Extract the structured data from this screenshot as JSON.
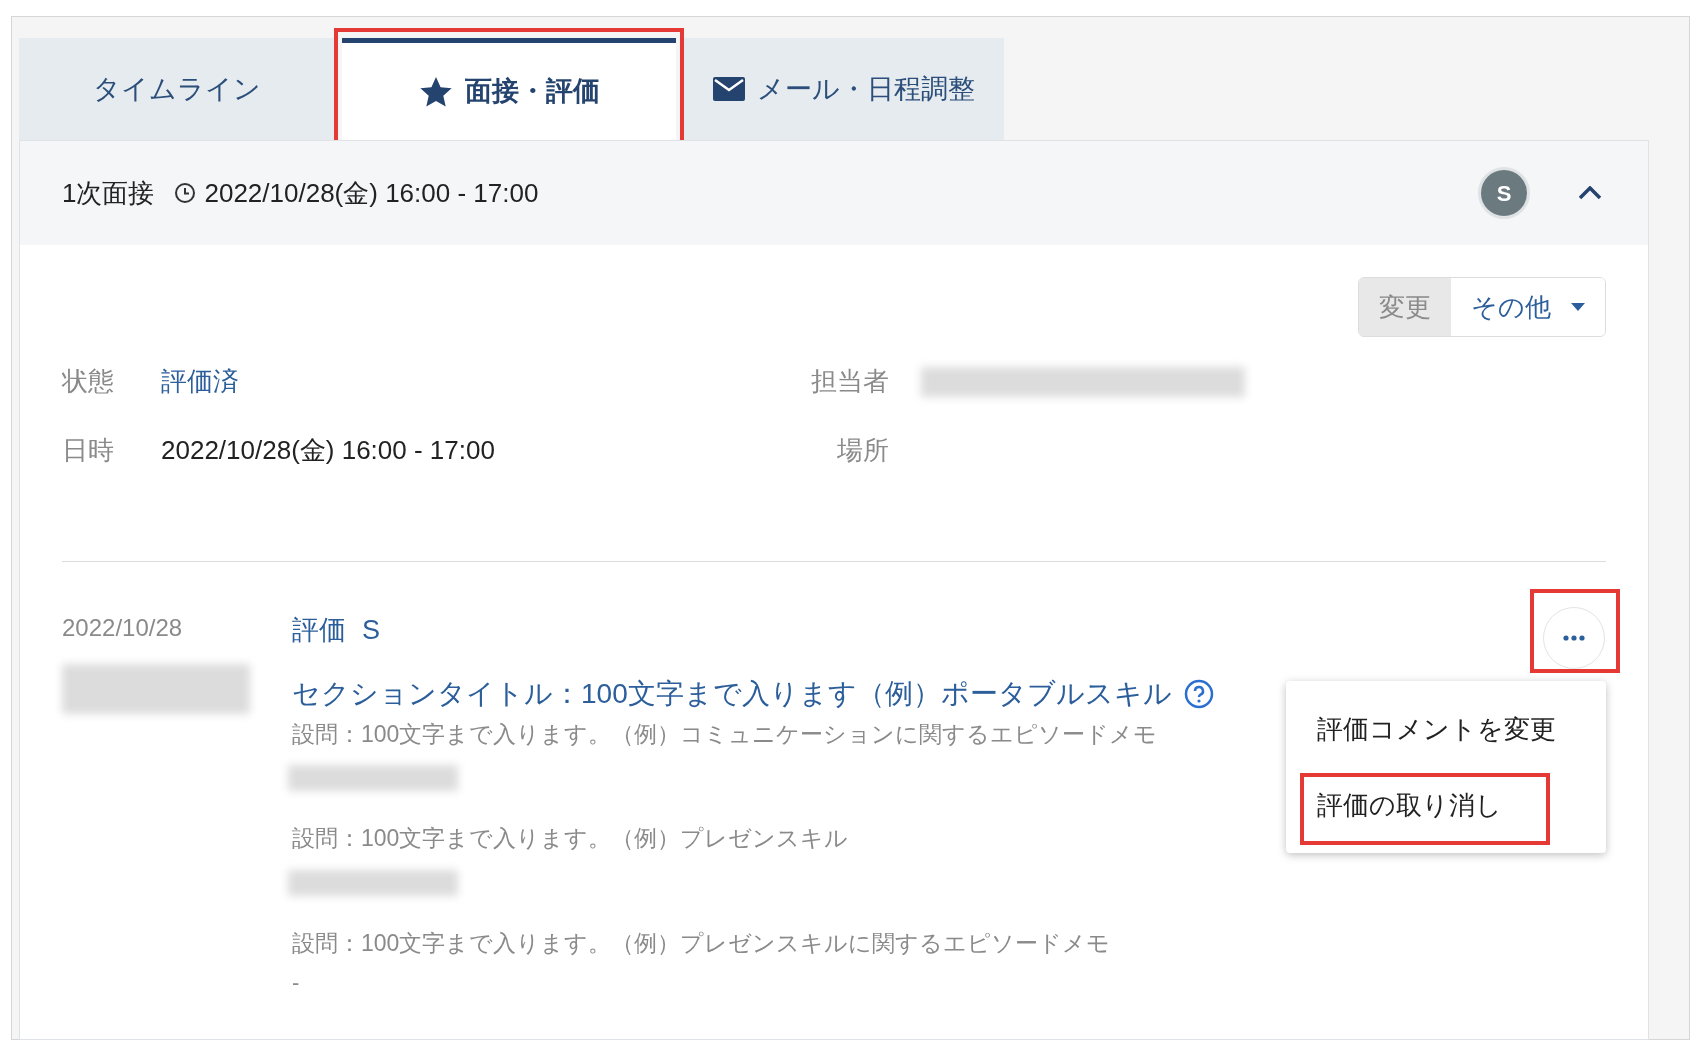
{
  "tabs": [
    {
      "label": "タイムライン",
      "selected": false,
      "highlighted": false
    },
    {
      "label": "面接・評価",
      "selected": true,
      "highlighted": true
    },
    {
      "label": "メール・日程調整",
      "selected": false,
      "highlighted": false
    }
  ],
  "interview": {
    "title": "1次面接",
    "time": "2022/10/28(金) 16:00 - 17:00",
    "avatar_letter": "S",
    "expanded": true
  },
  "actions": {
    "change": "変更",
    "other": "その他"
  },
  "details": [
    {
      "label": "状態",
      "value": "評価済",
      "kind": "link"
    },
    {
      "label": "担当者",
      "kind": "redacted"
    },
    {
      "label": "日時",
      "value": "2022/10/28(金) 16:00 - 17:00",
      "kind": "text"
    },
    {
      "label": "場所",
      "kind": "empty"
    }
  ],
  "evaluation": {
    "date": "2022/10/28",
    "title": "評価",
    "grade": "S",
    "more_highlighted": true,
    "section_title": "セクションタイトル：100文字まで入ります（例）ポータブルスキル",
    "questions": [
      {
        "label": "設問：100文字まで入ります。（例）コミュニケーションに関するエピソードメモ",
        "kind": "redacted"
      },
      {
        "label": "設問：100文字まで入ります。（例）プレゼンスキル",
        "kind": "redacted"
      },
      {
        "label": "設問：100文字まで入ります。（例）プレゼンスキルに関するエピソードメモ",
        "kind": "text",
        "answer": "-"
      }
    ]
  },
  "menu": [
    {
      "label": "評価コメントを変更",
      "highlighted": false
    },
    {
      "label": "評価の取り消し",
      "highlighted": true
    }
  ]
}
